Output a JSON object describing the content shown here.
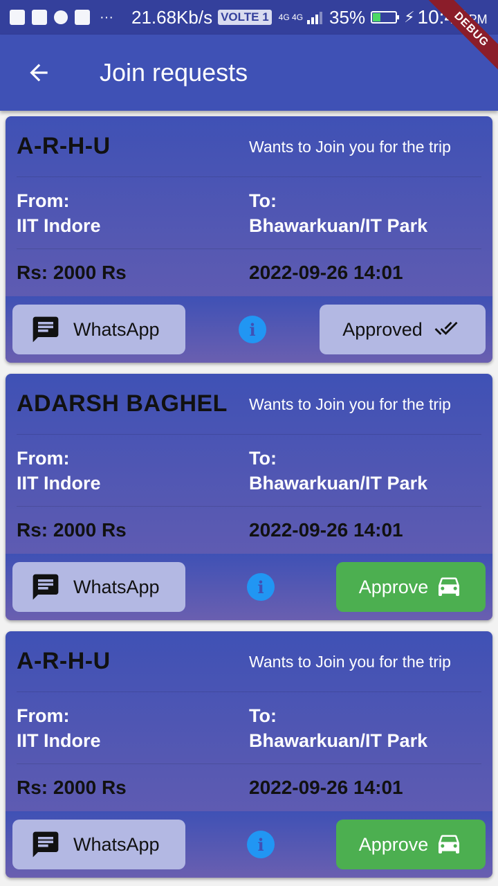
{
  "status_bar": {
    "speed": "21.68Kb/s",
    "volte": "VOLTE 1",
    "network": "4G 4G",
    "battery_percent": "35%",
    "battery_level": 0.35,
    "time": "10:47",
    "ampm": "PM",
    "icons": [
      "image-icon",
      "usb-icon",
      "android-icon",
      "mail-icon",
      "more-icon"
    ]
  },
  "debug_banner": "DEBUG",
  "appbar": {
    "title": "Join requests",
    "back_icon": "arrow-back-icon"
  },
  "requests": [
    {
      "name": "A-R-H-U",
      "wants": "Wants to Join you for the trip",
      "from_label": "From:",
      "from": "IIT Indore",
      "to_label": "To:",
      "to": "Bhawarkuan/IT Park",
      "price": "Rs: 2000 Rs",
      "datetime": "2022-09-26 14:01",
      "whatsapp_label": "WhatsApp",
      "info_glyph": "i",
      "status_label": "Approved",
      "status_icon": "done-all-icon",
      "status_type": "approved"
    },
    {
      "name": "ADARSH BAGHEL",
      "wants": "Wants to Join you for the trip",
      "from_label": "From:",
      "from": "IIT Indore",
      "to_label": "To:",
      "to": "Bhawarkuan/IT Park",
      "price": "Rs: 2000 Rs",
      "datetime": "2022-09-26 14:01",
      "whatsapp_label": "WhatsApp",
      "info_glyph": "i",
      "status_label": "Approve",
      "status_icon": "car-icon",
      "status_type": "approve"
    },
    {
      "name": "A-R-H-U",
      "wants": "Wants to Join you for the trip",
      "from_label": "From:",
      "from": "IIT Indore",
      "to_label": "To:",
      "to": "Bhawarkuan/IT Park",
      "price": "Rs: 2000 Rs",
      "datetime": "2022-09-26 14:01",
      "whatsapp_label": "WhatsApp",
      "info_glyph": "i",
      "status_label": "Approve",
      "status_icon": "car-icon",
      "status_type": "approve"
    }
  ],
  "colors": {
    "appbar": "#3f51b5",
    "statusbar": "#34409c",
    "approve_green": "#4caf50",
    "info_blue": "#2196f3",
    "button_lavender": "#b3b8e3"
  }
}
